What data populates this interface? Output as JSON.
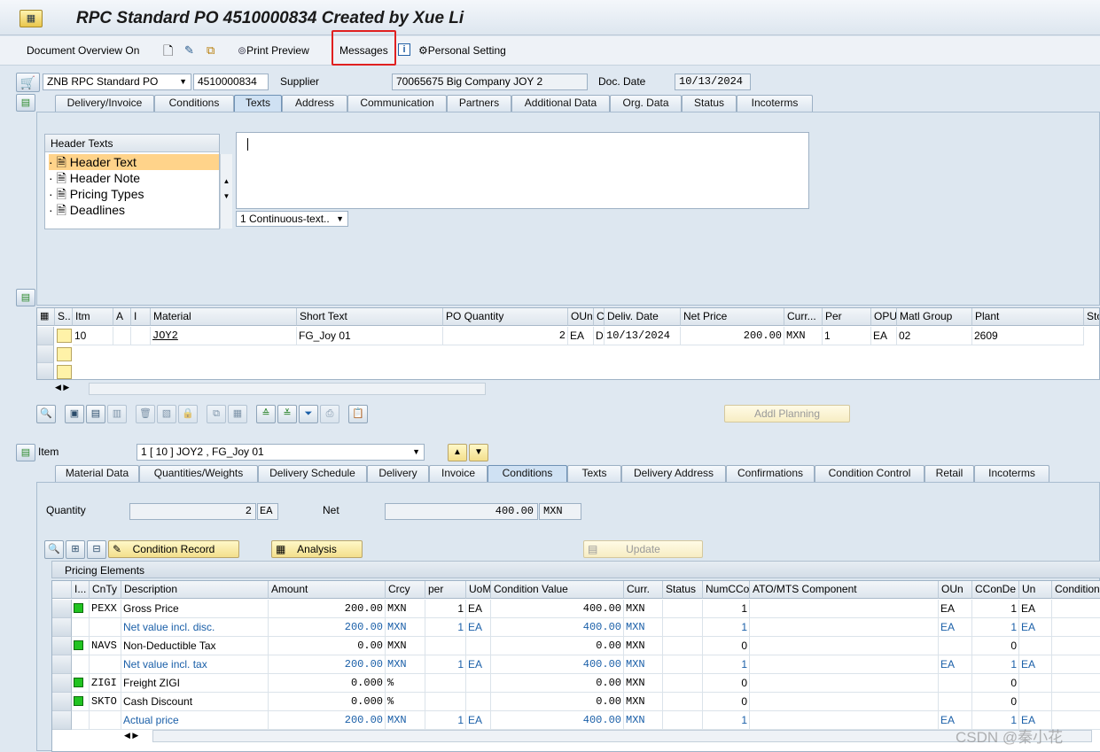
{
  "window": {
    "title": "RPC Standard PO 4510000834 Created by Xue Li"
  },
  "toolbar": {
    "doc_overview": "Document Overview On",
    "print_preview": "Print Preview",
    "messages": "Messages",
    "personal_setting": "Personal Setting"
  },
  "header": {
    "doc_type": "ZNB RPC Standard PO",
    "po_number": "4510000834",
    "supplier_label": "Supplier",
    "supplier_value": "70065675 Big Company JOY 2",
    "doc_date_label": "Doc. Date",
    "doc_date_value": "10/13/2024",
    "tabs": [
      "Delivery/Invoice",
      "Conditions",
      "Texts",
      "Address",
      "Communication",
      "Partners",
      "Additional Data",
      "Org. Data",
      "Status",
      "Incoterms"
    ],
    "active_tab": "Texts"
  },
  "texts": {
    "tree_title": "Header Texts",
    "items": [
      "Header Text",
      "Header Note",
      "Pricing Types",
      "Deadlines"
    ],
    "format_select": "1 Continuous-text.."
  },
  "items_table": {
    "columns": [
      "S..",
      "Itm",
      "A",
      "I",
      "Material",
      "Short Text",
      "PO Quantity",
      "OUn",
      "C",
      "Deliv. Date",
      "Net Price",
      "Curr...",
      "Per",
      "OPU",
      "Matl Group",
      "Plant",
      "Sto"
    ],
    "rows": [
      {
        "itm": "10",
        "a": "",
        "i": "",
        "material": "JOY2",
        "short_text": "FG_Joy 01",
        "po_qty": "2",
        "oun": "EA",
        "c": "D",
        "deliv_date": "10/13/2024",
        "net_price": "200.00",
        "curr": "MXN",
        "per": "1",
        "opu": "EA",
        "matl_group": "02",
        "plant": "2609"
      }
    ],
    "addl_planning": "Addl Planning"
  },
  "item_detail": {
    "item_label": "Item",
    "item_select": "1 [ 10 ] JOY2 , FG_Joy 01",
    "tabs": [
      "Material Data",
      "Quantities/Weights",
      "Delivery Schedule",
      "Delivery",
      "Invoice",
      "Conditions",
      "Texts",
      "Delivery Address",
      "Confirmations",
      "Condition Control",
      "Retail",
      "Incoterms"
    ],
    "active_tab": "Conditions",
    "quantity_label": "Quantity",
    "quantity_value": "2",
    "quantity_unit": "EA",
    "net_label": "Net",
    "net_value": "400.00",
    "net_currency": "MXN",
    "condition_record": "Condition Record",
    "analysis": "Analysis",
    "update": "Update",
    "pricing_title": "Pricing Elements"
  },
  "pricing": {
    "columns": [
      "I...",
      "CnTy",
      "Description",
      "Amount",
      "Crcy",
      "per",
      "UoM",
      "Condition Value",
      "Curr.",
      "Status",
      "NumCCo",
      "ATO/MTS Component",
      "OUn",
      "CConDe",
      "Un",
      "Condition"
    ],
    "rows": [
      {
        "green": true,
        "cnty": "PEXX",
        "desc": "Gross Price",
        "amount": "200.00",
        "crcy": "MXN",
        "per": "1",
        "uom": "EA",
        "value": "400.00",
        "curr": "MXN",
        "numcco": "1",
        "oun": "EA",
        "ccon": "1",
        "un": "EA",
        "sub": false
      },
      {
        "green": false,
        "cnty": "",
        "desc": "Net value incl. disc.",
        "amount": "200.00",
        "crcy": "MXN",
        "per": "1",
        "uom": "EA",
        "value": "400.00",
        "curr": "MXN",
        "numcco": "1",
        "oun": "EA",
        "ccon": "1",
        "un": "EA",
        "sub": true
      },
      {
        "green": true,
        "cnty": "NAVS",
        "desc": "Non-Deductible Tax",
        "amount": "0.00",
        "crcy": "MXN",
        "per": "",
        "uom": "",
        "value": "0.00",
        "curr": "MXN",
        "numcco": "0",
        "oun": "",
        "ccon": "0",
        "un": "",
        "sub": false
      },
      {
        "green": false,
        "cnty": "",
        "desc": "Net value incl. tax",
        "amount": "200.00",
        "crcy": "MXN",
        "per": "1",
        "uom": "EA",
        "value": "400.00",
        "curr": "MXN",
        "numcco": "1",
        "oun": "EA",
        "ccon": "1",
        "un": "EA",
        "sub": true
      },
      {
        "green": true,
        "cnty": "ZIGI",
        "desc": "Freight ZIGI",
        "amount": "0.000",
        "crcy": "%",
        "per": "",
        "uom": "",
        "value": "0.00",
        "curr": "MXN",
        "numcco": "0",
        "oun": "",
        "ccon": "0",
        "un": "",
        "sub": false
      },
      {
        "green": true,
        "cnty": "SKTO",
        "desc": "Cash Discount",
        "amount": "0.000",
        "crcy": "%",
        "per": "",
        "uom": "",
        "value": "0.00",
        "curr": "MXN",
        "numcco": "0",
        "oun": "",
        "ccon": "0",
        "un": "",
        "sub": false
      },
      {
        "green": false,
        "cnty": "",
        "desc": "Actual price",
        "amount": "200.00",
        "crcy": "MXN",
        "per": "1",
        "uom": "EA",
        "value": "400.00",
        "curr": "MXN",
        "numcco": "1",
        "oun": "EA",
        "ccon": "1",
        "un": "EA",
        "sub": true
      }
    ]
  },
  "watermark": "CSDN @秦小花"
}
